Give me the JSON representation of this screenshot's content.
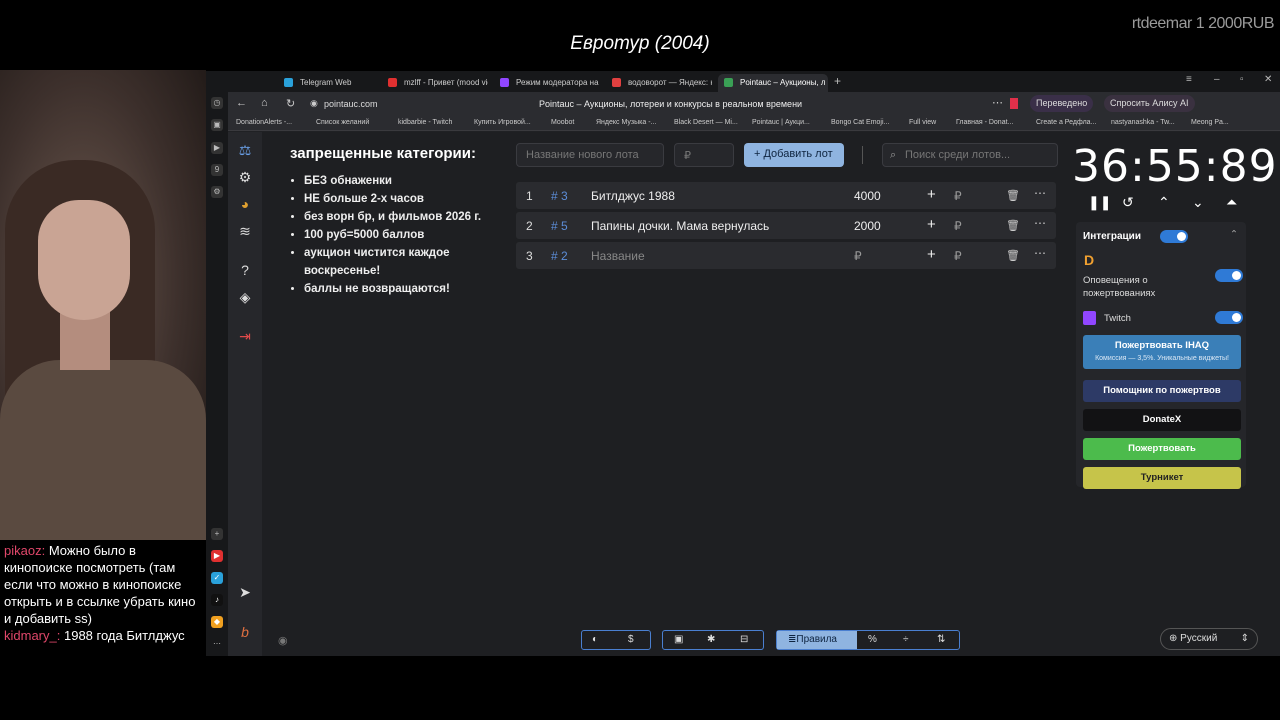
{
  "stream": {
    "title": "Евротур (2004)",
    "corner_text": "rtdeemar 1 2000RUB",
    "chat": [
      {
        "user": "pikaoz:",
        "text": "Можно было в кинопоиске посмотреть (там если что можно в кинопоиске открыть и в ссылке убрать кино и добавить ss)"
      },
      {
        "user": "kidmary_:",
        "text": "1988 года Битлджус"
      }
    ]
  },
  "browser": {
    "tabs": [
      {
        "label": "Telegram Web",
        "color": "#2aa1da"
      },
      {
        "label": "mzlff - Привет (mood vide",
        "color": "#e03030"
      },
      {
        "label": "Режим модератора на ка",
        "color": "#9146ff"
      },
      {
        "label": "водоворот — Яндекс: нашл",
        "color": "#e04040"
      },
      {
        "label": "Pointauc – Аукционы, л",
        "color": "#3aa055"
      }
    ],
    "url": "pointauc.com",
    "page_title": "Pointauc – Аукционы, лотереи и конкурсы в реальном времени",
    "translated_label": "Переведено",
    "alice_label": "Спросить Алису AI",
    "bookmarks": [
      "DonationAlerts -...",
      "Список желаний",
      "kidbarbie - Twitch",
      "Купить Игровой...",
      "Moobot",
      "Яндекс Музыка -...",
      "Black Desert — Mi...",
      "Pointauc | Аукци...",
      "Bongo Cat Emoji...",
      "Full view",
      "Главная - Donat...",
      "Create a Редфла...",
      "nastyanashka - Tw...",
      "Meong Pa..."
    ]
  },
  "auction": {
    "rules_title": "запрещенные категории:",
    "rules": [
      "БЕЗ обнаженки",
      "НЕ больше 2-х часов",
      "без ворн бр, и фильмов 2026 г.",
      "100 руб=5000 баллов",
      "аукцион чистится каждое воскресенье!",
      "баллы не возвращаются!"
    ],
    "new_lot_placeholder": "Название нового лота",
    "amount_placeholder": "₽",
    "add_lot_label": "Добавить лот",
    "search_placeholder": "Поиск среди лотов...",
    "lots": [
      {
        "index": "1",
        "id": "# 3",
        "name": "Битлджус 1988",
        "amount": "4000"
      },
      {
        "index": "2",
        "id": "# 5",
        "name": "Папины дочки. Мама вернулась",
        "amount": "2000"
      },
      {
        "index": "3",
        "id": "# 2",
        "name": "Название",
        "amount": "₽"
      }
    ],
    "currency": "₽"
  },
  "timer": {
    "value": "36:55:89"
  },
  "integrations": {
    "title": "Интеграции",
    "donation_alerts_label": "Оповещения о пожертвованиях",
    "twitch_label": "Twitch",
    "donate_ihaq_label": "Пожертвовать IHAQ",
    "donate_ihaq_sub": "Комиссия — 3,5%. Уникальные виджеты!",
    "helper_label": "Помощник по пожертвов",
    "donatex_label": "DonateX",
    "donate_label": "Пожертвовать",
    "turnstile_label": "Турникет"
  },
  "footer": {
    "rules_label": "Правила",
    "language": "Русский"
  }
}
